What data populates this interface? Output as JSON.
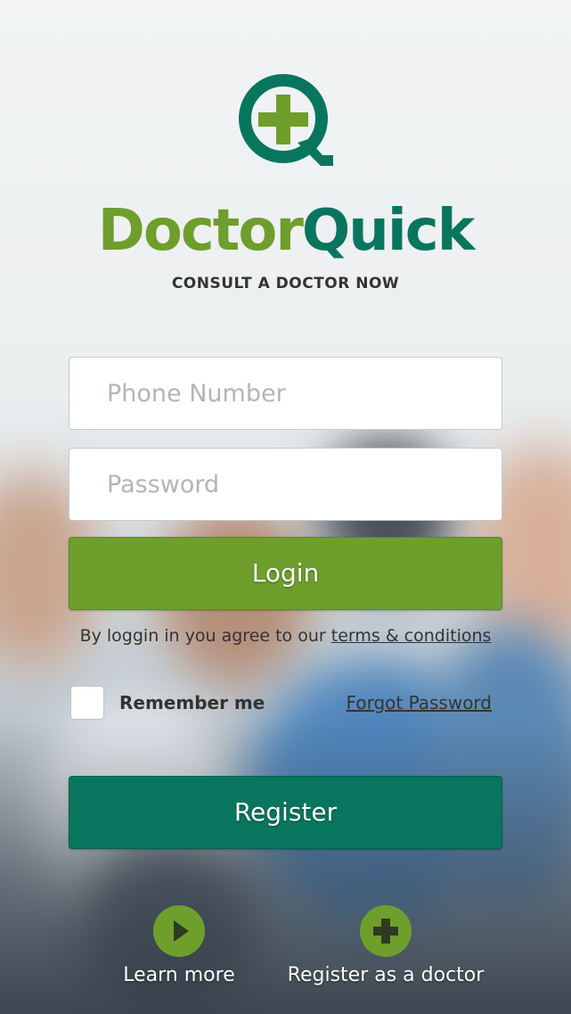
{
  "brand": {
    "name_part1": "Doctor",
    "name_part2": "Quick",
    "tagline": "CONSULT A DOCTOR NOW",
    "color_green": "#6e9e2c",
    "color_teal": "#08765e"
  },
  "login_form": {
    "phone_placeholder": "Phone Number",
    "phone_value": "",
    "password_placeholder": "Password",
    "password_value": "",
    "login_label": "Login",
    "terms_prefix": "By loggin in you agree to our ",
    "terms_link": "terms & conditions",
    "remember_label": "Remember me",
    "remember_checked": false,
    "forgot_label": "Forgot Password",
    "register_label": "Register"
  },
  "footer": {
    "learn_more_label": "Learn more",
    "learn_more_icon": "play-icon",
    "register_doctor_label": "Register as a doctor",
    "register_doctor_icon": "plus-icon"
  }
}
